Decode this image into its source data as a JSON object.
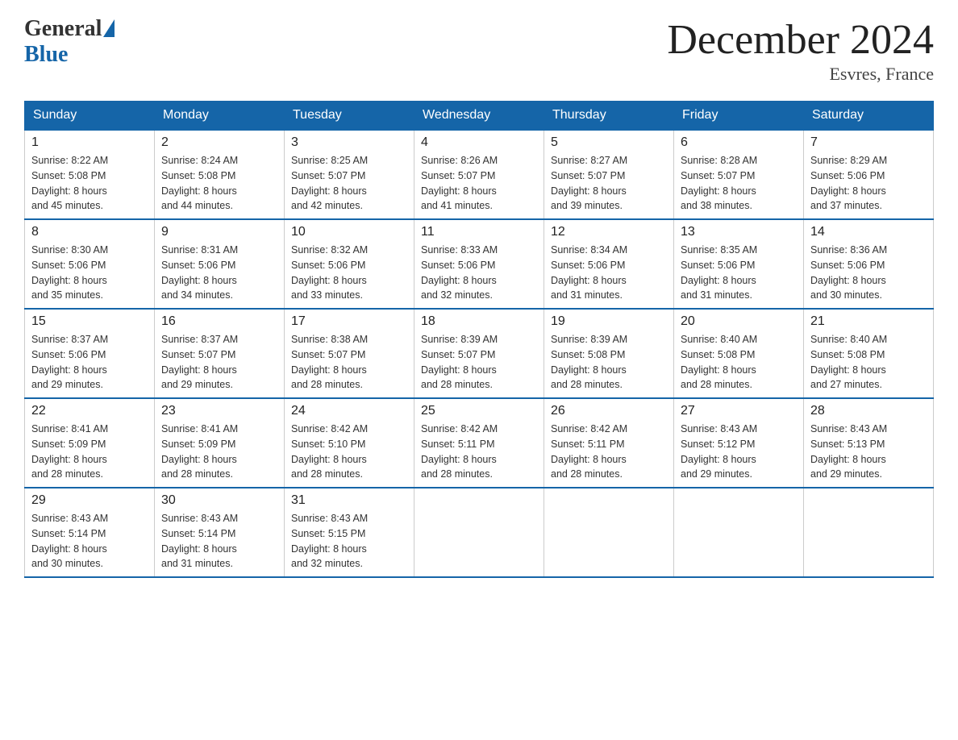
{
  "logo": {
    "general": "General",
    "blue": "Blue"
  },
  "title": "December 2024",
  "subtitle": "Esvres, France",
  "days_of_week": [
    "Sunday",
    "Monday",
    "Tuesday",
    "Wednesday",
    "Thursday",
    "Friday",
    "Saturday"
  ],
  "weeks": [
    [
      {
        "day": "1",
        "sunrise": "8:22 AM",
        "sunset": "5:08 PM",
        "daylight": "8 hours and 45 minutes."
      },
      {
        "day": "2",
        "sunrise": "8:24 AM",
        "sunset": "5:08 PM",
        "daylight": "8 hours and 44 minutes."
      },
      {
        "day": "3",
        "sunrise": "8:25 AM",
        "sunset": "5:07 PM",
        "daylight": "8 hours and 42 minutes."
      },
      {
        "day": "4",
        "sunrise": "8:26 AM",
        "sunset": "5:07 PM",
        "daylight": "8 hours and 41 minutes."
      },
      {
        "day": "5",
        "sunrise": "8:27 AM",
        "sunset": "5:07 PM",
        "daylight": "8 hours and 39 minutes."
      },
      {
        "day": "6",
        "sunrise": "8:28 AM",
        "sunset": "5:07 PM",
        "daylight": "8 hours and 38 minutes."
      },
      {
        "day": "7",
        "sunrise": "8:29 AM",
        "sunset": "5:06 PM",
        "daylight": "8 hours and 37 minutes."
      }
    ],
    [
      {
        "day": "8",
        "sunrise": "8:30 AM",
        "sunset": "5:06 PM",
        "daylight": "8 hours and 35 minutes."
      },
      {
        "day": "9",
        "sunrise": "8:31 AM",
        "sunset": "5:06 PM",
        "daylight": "8 hours and 34 minutes."
      },
      {
        "day": "10",
        "sunrise": "8:32 AM",
        "sunset": "5:06 PM",
        "daylight": "8 hours and 33 minutes."
      },
      {
        "day": "11",
        "sunrise": "8:33 AM",
        "sunset": "5:06 PM",
        "daylight": "8 hours and 32 minutes."
      },
      {
        "day": "12",
        "sunrise": "8:34 AM",
        "sunset": "5:06 PM",
        "daylight": "8 hours and 31 minutes."
      },
      {
        "day": "13",
        "sunrise": "8:35 AM",
        "sunset": "5:06 PM",
        "daylight": "8 hours and 31 minutes."
      },
      {
        "day": "14",
        "sunrise": "8:36 AM",
        "sunset": "5:06 PM",
        "daylight": "8 hours and 30 minutes."
      }
    ],
    [
      {
        "day": "15",
        "sunrise": "8:37 AM",
        "sunset": "5:06 PM",
        "daylight": "8 hours and 29 minutes."
      },
      {
        "day": "16",
        "sunrise": "8:37 AM",
        "sunset": "5:07 PM",
        "daylight": "8 hours and 29 minutes."
      },
      {
        "day": "17",
        "sunrise": "8:38 AM",
        "sunset": "5:07 PM",
        "daylight": "8 hours and 28 minutes."
      },
      {
        "day": "18",
        "sunrise": "8:39 AM",
        "sunset": "5:07 PM",
        "daylight": "8 hours and 28 minutes."
      },
      {
        "day": "19",
        "sunrise": "8:39 AM",
        "sunset": "5:08 PM",
        "daylight": "8 hours and 28 minutes."
      },
      {
        "day": "20",
        "sunrise": "8:40 AM",
        "sunset": "5:08 PM",
        "daylight": "8 hours and 28 minutes."
      },
      {
        "day": "21",
        "sunrise": "8:40 AM",
        "sunset": "5:08 PM",
        "daylight": "8 hours and 27 minutes."
      }
    ],
    [
      {
        "day": "22",
        "sunrise": "8:41 AM",
        "sunset": "5:09 PM",
        "daylight": "8 hours and 28 minutes."
      },
      {
        "day": "23",
        "sunrise": "8:41 AM",
        "sunset": "5:09 PM",
        "daylight": "8 hours and 28 minutes."
      },
      {
        "day": "24",
        "sunrise": "8:42 AM",
        "sunset": "5:10 PM",
        "daylight": "8 hours and 28 minutes."
      },
      {
        "day": "25",
        "sunrise": "8:42 AM",
        "sunset": "5:11 PM",
        "daylight": "8 hours and 28 minutes."
      },
      {
        "day": "26",
        "sunrise": "8:42 AM",
        "sunset": "5:11 PM",
        "daylight": "8 hours and 28 minutes."
      },
      {
        "day": "27",
        "sunrise": "8:43 AM",
        "sunset": "5:12 PM",
        "daylight": "8 hours and 29 minutes."
      },
      {
        "day": "28",
        "sunrise": "8:43 AM",
        "sunset": "5:13 PM",
        "daylight": "8 hours and 29 minutes."
      }
    ],
    [
      {
        "day": "29",
        "sunrise": "8:43 AM",
        "sunset": "5:14 PM",
        "daylight": "8 hours and 30 minutes."
      },
      {
        "day": "30",
        "sunrise": "8:43 AM",
        "sunset": "5:14 PM",
        "daylight": "8 hours and 31 minutes."
      },
      {
        "day": "31",
        "sunrise": "8:43 AM",
        "sunset": "5:15 PM",
        "daylight": "8 hours and 32 minutes."
      },
      null,
      null,
      null,
      null
    ]
  ],
  "labels": {
    "sunrise": "Sunrise: ",
    "sunset": "Sunset: ",
    "daylight": "Daylight: "
  }
}
